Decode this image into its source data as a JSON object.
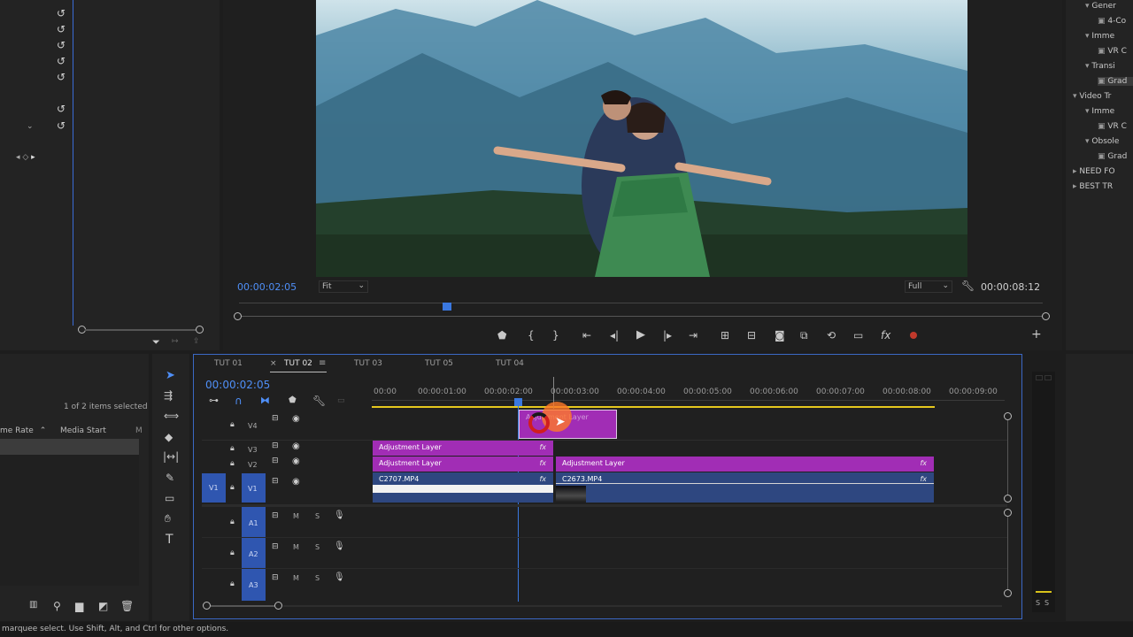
{
  "program": {
    "timecode_current": "00:00:02:05",
    "fit_select": "Fit",
    "resolution_select": "Full",
    "timecode_duration": "00:00:08:12"
  },
  "project": {
    "selection_status": "1 of 2 items selected",
    "columns": [
      "me Rate",
      "Media Start"
    ]
  },
  "effects_tree": [
    {
      "label": "Gener",
      "indent": 1,
      "arrow": "▾"
    },
    {
      "label": "4-Co",
      "indent": 2,
      "arrow": ""
    },
    {
      "label": "Imme",
      "indent": 1,
      "arrow": "▾"
    },
    {
      "label": "VR C",
      "indent": 2,
      "arrow": ""
    },
    {
      "label": "Transi",
      "indent": 1,
      "arrow": "▾"
    },
    {
      "label": "Grad",
      "indent": 2,
      "arrow": ""
    },
    {
      "label": "Video Tr",
      "indent": 0,
      "arrow": "▾"
    },
    {
      "label": "Imme",
      "indent": 1,
      "arrow": "▾"
    },
    {
      "label": "VR C",
      "indent": 2,
      "arrow": ""
    },
    {
      "label": "Obsole",
      "indent": 1,
      "arrow": "▾"
    },
    {
      "label": "Grad",
      "indent": 2,
      "arrow": ""
    },
    {
      "label": "NEED FO",
      "indent": 0,
      "arrow": "▸"
    },
    {
      "label": "BEST TR",
      "indent": 0,
      "arrow": "▸"
    }
  ],
  "timeline": {
    "tabs": [
      "TUT 01",
      "TUT 02",
      "TUT 03",
      "TUT 05",
      "TUT 04"
    ],
    "active_tab": "TUT 02",
    "timecode": "00:00:02:05",
    "ruler": [
      "00:00",
      "00:00:01:00",
      "00:00:02:00",
      "00:00:03:00",
      "00:00:04:00",
      "00:00:05:00",
      "00:00:06:00",
      "00:00:07:00",
      "00:00:08:00",
      "00:00:09:00"
    ],
    "tracks_video": [
      "V4",
      "V3",
      "V2",
      "V1"
    ],
    "source_patch": "V1",
    "tracks_audio": [
      "A1",
      "A2",
      "A3"
    ],
    "mute_label": "M",
    "solo_label": "S",
    "clips": {
      "v4_adj": "Adjustment Layer",
      "v3_adj": "Adjustment Layer",
      "v2_adj_a": "Adjustment Layer",
      "v2_adj_b": "Adjustment Layer",
      "v1_a": "C2707.MP4",
      "v1_b": "C2673.MP4",
      "fx": "fx"
    }
  },
  "meter_labels": [
    "S",
    "S"
  ],
  "status_bar": "marquee select. Use Shift, Alt, and Ctrl for other options.",
  "colors": {
    "accent_blue": "#4f8ff7",
    "adjustment_clip": "#a12db5",
    "video_clip": "#2e4780",
    "work_area": "#e6c81e",
    "record_red": "#c0392b"
  }
}
